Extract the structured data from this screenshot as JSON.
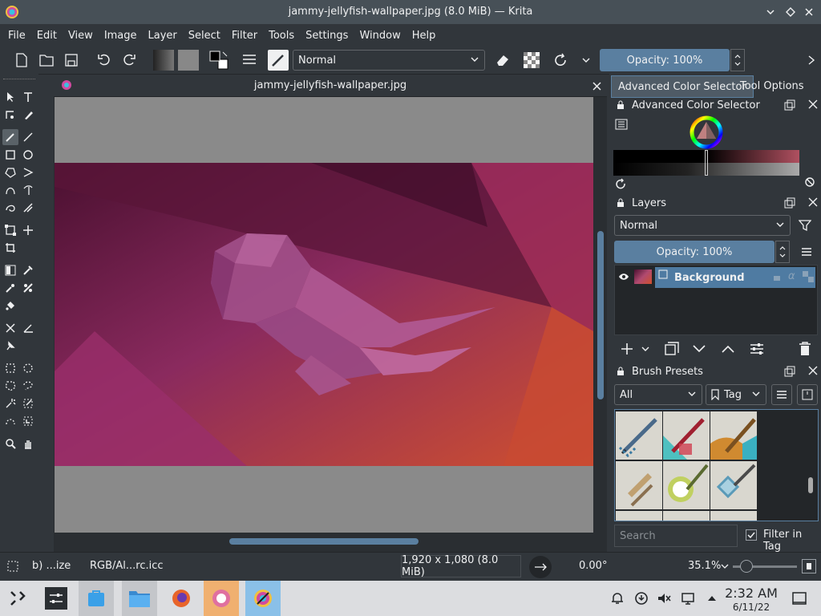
{
  "window": {
    "title": "jammy-jellyfish-wallpaper.jpg (8.0 MiB) — Krita"
  },
  "menu": [
    "File",
    "Edit",
    "View",
    "Image",
    "Layer",
    "Select",
    "Filter",
    "Tools",
    "Settings",
    "Window",
    "Help"
  ],
  "toolbar": {
    "blend_mode": "Normal",
    "opacity": "Opacity: 100%"
  },
  "document": {
    "tab_title": "jammy-jellyfish-wallpaper.jpg"
  },
  "dock": {
    "tabs": [
      "Advanced Color Selector",
      "Tool Options"
    ],
    "color_selector_title": "Advanced Color Selector",
    "layers_title": "Layers",
    "layers_blend": "Normal",
    "layers_opacity": "Opacity:  100%",
    "layer_name": "Background",
    "brush_title": "Brush Presets",
    "brush_filter": "All",
    "brush_tag": "Tag",
    "brush_search_placeholder": "Search",
    "filter_in_tag": "Filter in Tag"
  },
  "status": {
    "brush": "b) ...ize",
    "color_profile": "RGB/Al...rc.icc",
    "image_size": "1,920 x 1,080 (8.0 MiB)",
    "rotation": "0.00°",
    "zoom": "35.1%"
  },
  "taskbar": {
    "time": "2:32 AM",
    "date": "6/11/22"
  },
  "colors": {
    "accent": "#5a7fa0",
    "bg": "#31363b",
    "selection": "#4f7ba2"
  }
}
